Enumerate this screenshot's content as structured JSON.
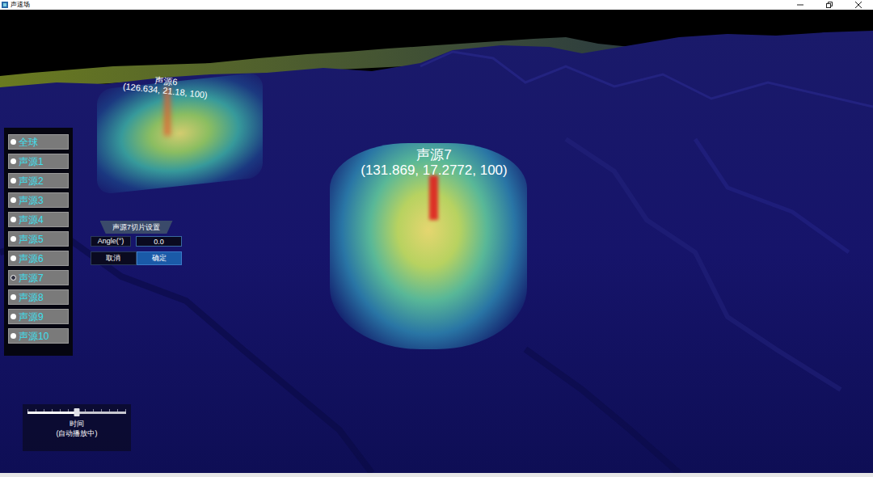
{
  "window": {
    "title": "声速场"
  },
  "sources_list": {
    "items": [
      {
        "label": "全球",
        "selected": false
      },
      {
        "label": "声源1",
        "selected": false
      },
      {
        "label": "声源2",
        "selected": false
      },
      {
        "label": "声源3",
        "selected": false
      },
      {
        "label": "声源4",
        "selected": false
      },
      {
        "label": "声源5",
        "selected": false
      },
      {
        "label": "声源6",
        "selected": false
      },
      {
        "label": "声源7",
        "selected": true
      },
      {
        "label": "声源8",
        "selected": false
      },
      {
        "label": "声源9",
        "selected": false
      },
      {
        "label": "声源10",
        "selected": false
      }
    ]
  },
  "slice_panel": {
    "title": "声源7切片设置",
    "field": {
      "label": "Angle(°)",
      "value": "0.0"
    },
    "buttons": [
      {
        "label": "取消",
        "primary": false
      },
      {
        "label": "确定",
        "primary": true
      }
    ]
  },
  "time_slider": {
    "level": 0.5,
    "label": "时间",
    "status": "(自动播放中)"
  },
  "scene": {
    "labels": [
      {
        "name": "声源6",
        "coords": "(126.634, 21.18, 100)"
      },
      {
        "name": "声源7",
        "coords": "(131.869, 17.2772, 100)"
      }
    ]
  }
}
